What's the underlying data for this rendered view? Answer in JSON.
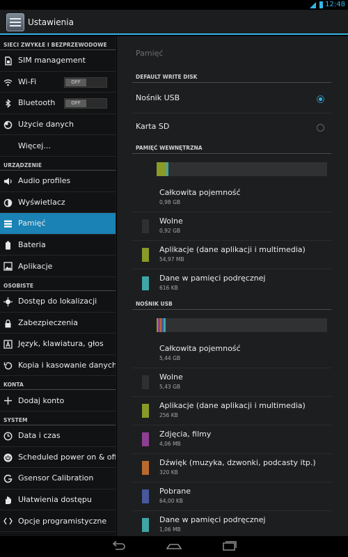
{
  "status_bar": {
    "time": "12:48"
  },
  "action_bar": {
    "title": "Ustawienia"
  },
  "sidebar": {
    "sections": [
      {
        "header": "SIECI ZWYKŁE I BEZPRZEWODOWE"
      },
      {
        "header": "URZĄDZENIE"
      },
      {
        "header": "OSOBISTE"
      },
      {
        "header": "KONTA"
      },
      {
        "header": "SYSTEM"
      }
    ],
    "items": [
      {
        "label": "SIM management",
        "icon": "sim-card-icon"
      },
      {
        "label": "Wi-Fi",
        "icon": "wifi-icon",
        "toggle": "OFF"
      },
      {
        "label": "Bluetooth",
        "icon": "bluetooth-icon",
        "toggle": "OFF"
      },
      {
        "label": "Użycie danych",
        "icon": "data-usage-icon"
      },
      {
        "label": "Więcej..."
      },
      {
        "label": "Audio profiles",
        "icon": "audio-profiles-icon"
      },
      {
        "label": "Wyświetlacz",
        "icon": "display-icon"
      },
      {
        "label": "Pamięć",
        "icon": "storage-icon",
        "active": true
      },
      {
        "label": "Bateria",
        "icon": "battery-icon"
      },
      {
        "label": "Aplikacje",
        "icon": "apps-icon"
      },
      {
        "label": "Dostęp do lokalizacji",
        "icon": "location-icon"
      },
      {
        "label": "Zabezpieczenia",
        "icon": "lock-icon"
      },
      {
        "label": "Język, klawiatura, głos",
        "icon": "language-icon"
      },
      {
        "label": "Kopia i kasowanie danych",
        "icon": "backup-icon"
      },
      {
        "label": "Dodaj konto",
        "icon": "add-icon"
      },
      {
        "label": "Data i czas",
        "icon": "clock-icon"
      },
      {
        "label": "Scheduled power on & off",
        "icon": "power-icon"
      },
      {
        "label": "Gsensor Calibration",
        "icon": "gsensor-icon"
      },
      {
        "label": "Ułatwienia dostępu",
        "icon": "accessibility-icon"
      },
      {
        "label": "Opcje programistyczne",
        "icon": "developer-icon"
      }
    ]
  },
  "main": {
    "title": "Pamięć",
    "default_write_disk": {
      "header": "DEFAULT WRITE DISK",
      "options": [
        {
          "label": "Nośnik USB",
          "selected": true
        },
        {
          "label": "Karta SD",
          "selected": false
        }
      ]
    },
    "internal": {
      "header": "PAMIĘĆ WEWNĘTRZNA",
      "usage_segments": [
        {
          "color": "#8a9a26",
          "fraction": 0.056
        },
        {
          "color": "#3fa5a5",
          "fraction": 0.011
        }
      ],
      "rows": [
        {
          "name": "Całkowita pojemność",
          "value": "0,98 GB",
          "color": ""
        },
        {
          "name": "Wolne",
          "value": "0,92 GB",
          "color": "#2f3032"
        },
        {
          "name": "Aplikacje (dane aplikacji i multimedia)",
          "value": "54,97 MB",
          "color": "#8a9a26"
        },
        {
          "name": "Dane w pamięci podręcznej",
          "value": "616 KB",
          "color": "#3fa5a5"
        }
      ]
    },
    "usb": {
      "header": "NOŚNIK USB",
      "usage_segments": [
        {
          "color": "#8a9a26",
          "fraction": 0.006
        },
        {
          "color": "#8e3f91",
          "fraction": 0.011
        },
        {
          "color": "#b86a2d",
          "fraction": 0.006
        },
        {
          "color": "#47599c",
          "fraction": 0.011
        },
        {
          "color": "#3fa5a5",
          "fraction": 0.011
        }
      ],
      "rows": [
        {
          "name": "Całkowita pojemność",
          "value": "5,44 GB",
          "color": ""
        },
        {
          "name": "Wolne",
          "value": "5,43 GB",
          "color": "#2f3032"
        },
        {
          "name": "Aplikacje (dane aplikacji i multimedia)",
          "value": "256 KB",
          "color": "#8a9a26"
        },
        {
          "name": "Zdjęcia, filmy",
          "value": "4,06 MB",
          "color": "#8e3f91"
        },
        {
          "name": "Dźwięk (muzyka, dzwonki, podcasty itp.)",
          "value": "320 KB",
          "color": "#b86a2d"
        },
        {
          "name": "Pobrane",
          "value": "64,00 KB",
          "color": "#47599c"
        },
        {
          "name": "Dane w pamięci podręcznej",
          "value": "1,06 MB",
          "color": "#3fa5a5"
        }
      ]
    }
  },
  "nav_bar": {
    "buttons": [
      "back-icon",
      "home-icon",
      "recent-apps-icon"
    ]
  },
  "colors": {
    "accent": "#33b5e5",
    "active_item": "#1a82b4"
  }
}
